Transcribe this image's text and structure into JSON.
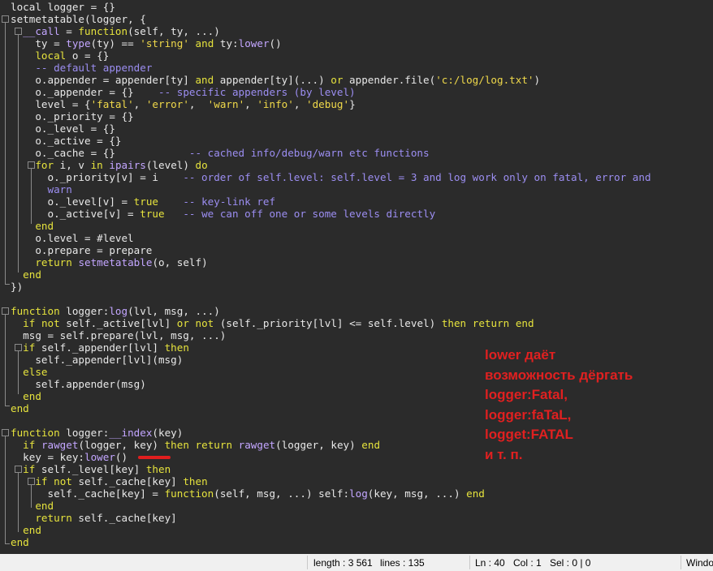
{
  "code": [
    [
      [
        "local logger = {}",
        "t"
      ]
    ],
    [
      [
        "setmetatable",
        "t"
      ],
      [
        "(logger, {",
        "t"
      ]
    ],
    [
      [
        "  ",
        "t"
      ],
      [
        "__call",
        "fn"
      ],
      [
        " = ",
        "t"
      ],
      [
        "function",
        "kw"
      ],
      [
        "(self, ty, ...)",
        "t"
      ]
    ],
    [
      [
        "    ty = ",
        "t"
      ],
      [
        "type",
        "fn"
      ],
      [
        "(ty) == ",
        "t"
      ],
      [
        "'string'",
        "st"
      ],
      [
        " ",
        "t"
      ],
      [
        "and",
        "kw"
      ],
      [
        " ty:",
        "t"
      ],
      [
        "lower",
        "fn"
      ],
      [
        "()",
        "t"
      ]
    ],
    [
      [
        "    ",
        "t"
      ],
      [
        "local",
        "kw"
      ],
      [
        " o = {}",
        "t"
      ]
    ],
    [
      [
        "    ",
        "t"
      ],
      [
        "-- default appender",
        "cm"
      ]
    ],
    [
      [
        "    o.appender = appender[ty] ",
        "t"
      ],
      [
        "and",
        "kw"
      ],
      [
        " appender[ty](...) ",
        "t"
      ],
      [
        "or",
        "kw"
      ],
      [
        " appender.file(",
        "t"
      ],
      [
        "'c:/log/log.txt'",
        "st"
      ],
      [
        ")",
        "t"
      ]
    ],
    [
      [
        "    o._appender = {}    ",
        "t"
      ],
      [
        "-- specific appenders (by level)",
        "cm"
      ]
    ],
    [
      [
        "    level = {",
        "t"
      ],
      [
        "'fatal'",
        "st"
      ],
      [
        ", ",
        "t"
      ],
      [
        "'error'",
        "st"
      ],
      [
        ",  ",
        "t"
      ],
      [
        "'warn'",
        "st"
      ],
      [
        ", ",
        "t"
      ],
      [
        "'info'",
        "st"
      ],
      [
        ", ",
        "t"
      ],
      [
        "'debug'",
        "st"
      ],
      [
        "}",
        "t"
      ]
    ],
    [
      [
        "    o._priority = {}",
        "t"
      ]
    ],
    [
      [
        "    o._level = {}",
        "t"
      ]
    ],
    [
      [
        "    o._active = {}",
        "t"
      ]
    ],
    [
      [
        "    o._cache = {}            ",
        "t"
      ],
      [
        "-- cached info/debug/warn etc functions",
        "cm"
      ]
    ],
    [
      [
        "    ",
        "t"
      ],
      [
        "for",
        "kw"
      ],
      [
        " i, v ",
        "t"
      ],
      [
        "in",
        "kw"
      ],
      [
        " ",
        "t"
      ],
      [
        "ipairs",
        "fn"
      ],
      [
        "(level) ",
        "t"
      ],
      [
        "do",
        "kw"
      ]
    ],
    [
      [
        "      o._priority[v] = i    ",
        "t"
      ],
      [
        "-- order of self.level: self.level = 3 and log work only on fatal, error and",
        "cm"
      ]
    ],
    [
      [
        "      ",
        "t"
      ],
      [
        "warn",
        "cm"
      ]
    ],
    [
      [
        "      o._level[v] = ",
        "t"
      ],
      [
        "true",
        "kw"
      ],
      [
        "    ",
        "t"
      ],
      [
        "-- key-link ref",
        "cm"
      ]
    ],
    [
      [
        "      o._active[v] = ",
        "t"
      ],
      [
        "true",
        "kw"
      ],
      [
        "   ",
        "t"
      ],
      [
        "-- we can off one or some levels directly",
        "cm"
      ]
    ],
    [
      [
        "    ",
        "t"
      ],
      [
        "end",
        "kw"
      ]
    ],
    [
      [
        "    o.level = #level",
        "t"
      ]
    ],
    [
      [
        "    o.prepare = prepare",
        "t"
      ]
    ],
    [
      [
        "    ",
        "t"
      ],
      [
        "return",
        "kw"
      ],
      [
        " ",
        "t"
      ],
      [
        "setmetatable",
        "fn"
      ],
      [
        "(o, self)",
        "t"
      ]
    ],
    [
      [
        "  ",
        "t"
      ],
      [
        "end",
        "kw"
      ]
    ],
    [
      [
        "})",
        "t"
      ]
    ],
    [
      [
        "",
        "t"
      ]
    ],
    [
      [
        "function",
        "kw"
      ],
      [
        " logger:",
        "t"
      ],
      [
        "log",
        "fn"
      ],
      [
        "(lvl, msg, ...)",
        "t"
      ]
    ],
    [
      [
        "  ",
        "t"
      ],
      [
        "if",
        "kw"
      ],
      [
        " ",
        "t"
      ],
      [
        "not",
        "kw"
      ],
      [
        " self._active[lvl] ",
        "t"
      ],
      [
        "or",
        "kw"
      ],
      [
        " ",
        "t"
      ],
      [
        "not",
        "kw"
      ],
      [
        " (self._priority[lvl] <= self.level) ",
        "t"
      ],
      [
        "then",
        "kw"
      ],
      [
        " ",
        "t"
      ],
      [
        "return",
        "kw"
      ],
      [
        " ",
        "t"
      ],
      [
        "end",
        "kw"
      ]
    ],
    [
      [
        "  msg = self.prepare(lvl, msg, ...)",
        "t"
      ]
    ],
    [
      [
        "  ",
        "t"
      ],
      [
        "if",
        "kw"
      ],
      [
        " self._appender[lvl] ",
        "t"
      ],
      [
        "then",
        "kw"
      ]
    ],
    [
      [
        "    self._appender[lvl](msg)",
        "t"
      ]
    ],
    [
      [
        "  ",
        "t"
      ],
      [
        "else",
        "kw"
      ]
    ],
    [
      [
        "    self.appender(msg)",
        "t"
      ]
    ],
    [
      [
        "  ",
        "t"
      ],
      [
        "end",
        "kw"
      ]
    ],
    [
      [
        "end",
        "kw"
      ]
    ],
    [
      [
        "",
        "t"
      ]
    ],
    [
      [
        "function",
        "kw"
      ],
      [
        " logger:",
        "t"
      ],
      [
        "__index",
        "fn"
      ],
      [
        "(key)",
        "t"
      ]
    ],
    [
      [
        "  ",
        "t"
      ],
      [
        "if",
        "kw"
      ],
      [
        " ",
        "t"
      ],
      [
        "rawget",
        "fn"
      ],
      [
        "(logger, key) ",
        "t"
      ],
      [
        "then",
        "kw"
      ],
      [
        " ",
        "t"
      ],
      [
        "return",
        "kw"
      ],
      [
        " ",
        "t"
      ],
      [
        "rawget",
        "fn"
      ],
      [
        "(logger, key) ",
        "t"
      ],
      [
        "end",
        "kw"
      ]
    ],
    [
      [
        "  key = key:",
        "t"
      ],
      [
        "lower",
        "fn"
      ],
      [
        "()",
        "t"
      ]
    ],
    [
      [
        "  ",
        "t"
      ],
      [
        "if",
        "kw"
      ],
      [
        " self._level[key] ",
        "t"
      ],
      [
        "then",
        "kw"
      ]
    ],
    [
      [
        "    ",
        "t"
      ],
      [
        "if",
        "kw"
      ],
      [
        " ",
        "t"
      ],
      [
        "not",
        "kw"
      ],
      [
        " self._cache[key] ",
        "t"
      ],
      [
        "then",
        "kw"
      ]
    ],
    [
      [
        "      self._cache[key] = ",
        "t"
      ],
      [
        "function",
        "kw"
      ],
      [
        "(self, msg, ...) self:",
        "t"
      ],
      [
        "log",
        "fn"
      ],
      [
        "(key, msg, ...) ",
        "t"
      ],
      [
        "end",
        "kw"
      ]
    ],
    [
      [
        "    ",
        "t"
      ],
      [
        "end",
        "kw"
      ]
    ],
    [
      [
        "    ",
        "t"
      ],
      [
        "return",
        "kw"
      ],
      [
        " self._cache[key]",
        "t"
      ]
    ],
    [
      [
        "  ",
        "t"
      ],
      [
        "end",
        "kw"
      ]
    ],
    [
      [
        "end",
        "kw"
      ]
    ]
  ],
  "annotation": {
    "lines": [
      "lower даёт",
      "возможность дёргать",
      "logger:Fatal,",
      "logger:faTaL,",
      "logget:FATAL",
      "и т. п."
    ]
  },
  "status_bar": {
    "length": "length : 3 561",
    "lines": "lines : 135",
    "ln": "Ln : 40",
    "col": "Col : 1",
    "sel": "Sel : 0 | 0",
    "eol": "Windo"
  },
  "colors": {
    "background": "#2b2b2b",
    "keyword": "#e6e33d",
    "function": "#c3a6ff",
    "comment": "#9c8ef2",
    "string": "#f0d94a",
    "annotation": "#e02020"
  }
}
